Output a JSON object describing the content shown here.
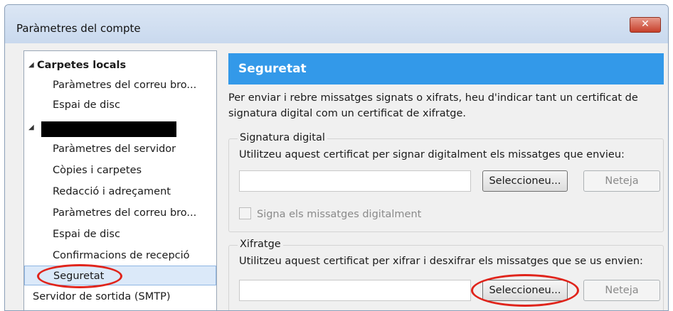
{
  "window": {
    "title": "Paràmetres del compte",
    "close_glyph": "✕"
  },
  "tree": {
    "local_folders": {
      "label": "Carpetes locals",
      "children": [
        "Paràmetres del correu bro...",
        "Espai de disc"
      ]
    },
    "account": {
      "children": [
        "Paràmetres del servidor",
        "Còpies i carpetes",
        "Redacció i adreçament",
        "Paràmetres del correu bro...",
        "Espai de disc",
        "Confirmacions de recepció",
        "Seguretat"
      ]
    },
    "smtp": "Servidor de sortida (SMTP)"
  },
  "panel": {
    "title": "Seguretat",
    "description": "Per enviar i rebre missatges signats o xifrats, heu d'indicar tant un certificat de signatura digital com un certificat de xifratge."
  },
  "signing": {
    "title": "Signatura digital",
    "instruction": "Utilitzeu aquest certificat per signar digitalment els missatges que envieu:",
    "certificate_value": "",
    "select_button": "Seleccioneu...",
    "clear_button": "Neteja",
    "checkbox_label": "Signa els missatges digitalment",
    "checkbox_checked": false
  },
  "encryption": {
    "title": "Xifratge",
    "instruction": "Utilitzeu aquest certificat per xifrar i desxifrar els missatges que se us envien:",
    "certificate_value": "",
    "select_button": "Seleccioneu...",
    "clear_button": "Neteja"
  },
  "colors": {
    "header": "#3399e9",
    "highlight_oval": "#e0241b"
  }
}
